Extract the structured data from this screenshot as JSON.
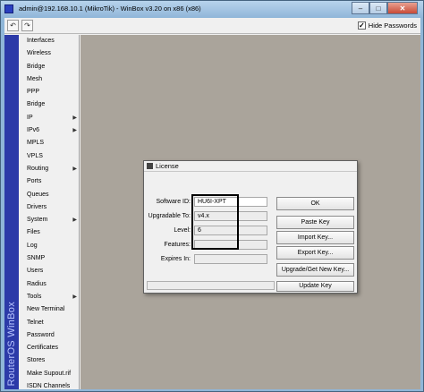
{
  "window": {
    "title": "admin@192.168.10.1 (MikroTik) - WinBox v3.20 on x86 (x86)",
    "controls": {
      "minimize": "–",
      "maximize": "□",
      "close": "✕"
    }
  },
  "toolbar": {
    "undo_glyph": "↶",
    "redo_glyph": "↷",
    "hide_passwords_label": "Hide Passwords",
    "hide_passwords_checked": true,
    "check_glyph": "✓"
  },
  "sidebar": {
    "brand": "RouterOS WinBox",
    "items": [
      {
        "label": "Interfaces",
        "has_submenu": false
      },
      {
        "label": "Wireless",
        "has_submenu": false
      },
      {
        "label": "Bridge",
        "has_submenu": false
      },
      {
        "label": "Mesh",
        "has_submenu": false
      },
      {
        "label": "PPP",
        "has_submenu": false
      },
      {
        "label": "Bridge",
        "has_submenu": false
      },
      {
        "label": "IP",
        "has_submenu": true
      },
      {
        "label": "IPv6",
        "has_submenu": true
      },
      {
        "label": "MPLS",
        "has_submenu": false
      },
      {
        "label": "VPLS",
        "has_submenu": false
      },
      {
        "label": "Routing",
        "has_submenu": true
      },
      {
        "label": "Ports",
        "has_submenu": false
      },
      {
        "label": "Queues",
        "has_submenu": false
      },
      {
        "label": "Drivers",
        "has_submenu": false
      },
      {
        "label": "System",
        "has_submenu": true
      },
      {
        "label": "Files",
        "has_submenu": false
      },
      {
        "label": "Log",
        "has_submenu": false
      },
      {
        "label": "SNMP",
        "has_submenu": false
      },
      {
        "label": "Users",
        "has_submenu": false
      },
      {
        "label": "Radius",
        "has_submenu": false
      },
      {
        "label": "Tools",
        "has_submenu": true
      },
      {
        "label": "New Terminal",
        "has_submenu": false
      },
      {
        "label": "Telnet",
        "has_submenu": false
      },
      {
        "label": "Password",
        "has_submenu": false
      },
      {
        "label": "Certificates",
        "has_submenu": false
      },
      {
        "label": "Stores",
        "has_submenu": false
      },
      {
        "label": "Make Supout.rif",
        "has_submenu": false
      },
      {
        "label": "ISDN Channels",
        "has_submenu": false
      }
    ],
    "submenu_arrow": "▶"
  },
  "license_dialog": {
    "title": "License",
    "fields": {
      "software_id": {
        "label": "Software ID:",
        "value": "HU6I-XPT"
      },
      "upgradable_to": {
        "label": "Upgradable To:",
        "value": "v4.x"
      },
      "level": {
        "label": "Level:",
        "value": "6"
      },
      "features": {
        "label": "Features:",
        "value": ""
      },
      "expires_in": {
        "label": "Expires In:",
        "value": ""
      }
    },
    "buttons": {
      "ok": "OK",
      "paste_key": "Paste Key",
      "import_key": "Import Key...",
      "export_key": "Export Key...",
      "upgrade_get_new_key": "Upgrade/Get New Key...",
      "update_key": "Update Key"
    },
    "status_text": ""
  }
}
